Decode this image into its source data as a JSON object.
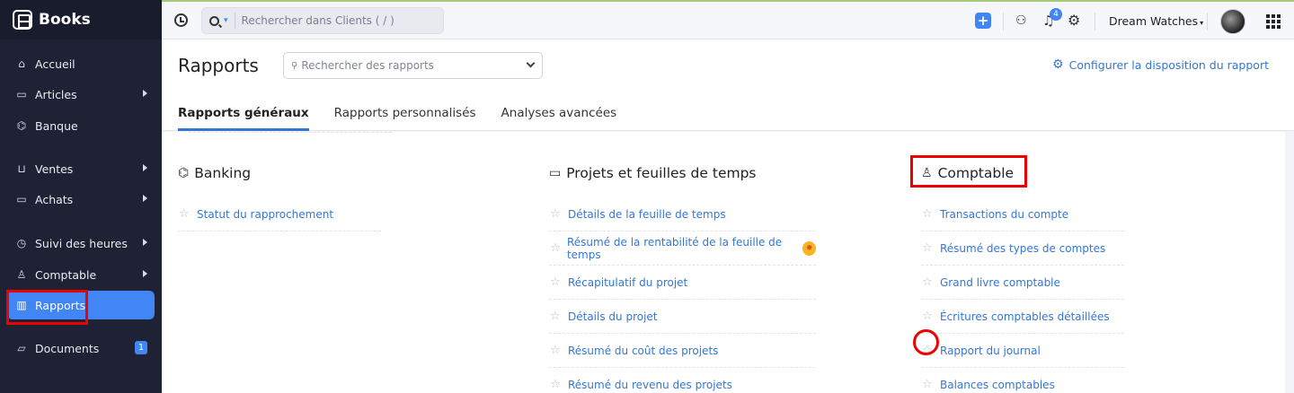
{
  "app": {
    "name": "Books"
  },
  "sidebar": {
    "items": [
      {
        "label": "Accueil",
        "icon": "home-icon"
      },
      {
        "label": "Articles",
        "icon": "bag-icon"
      },
      {
        "label": "Banque",
        "icon": "bank-icon"
      },
      {
        "label": "Ventes",
        "icon": "cart-icon"
      },
      {
        "label": "Achats",
        "icon": "bag-icon"
      },
      {
        "label": "Suivi des heures",
        "icon": "timer-icon"
      },
      {
        "label": "Comptable",
        "icon": "accountant-icon"
      },
      {
        "label": "Rapports",
        "icon": "chart-icon"
      },
      {
        "label": "Documents",
        "icon": "folder-icon",
        "badge": "1"
      }
    ],
    "active": "Rapports"
  },
  "topbar": {
    "search_placeholder": "Rechercher dans Clients ( / )",
    "notifications_count": "4",
    "org_name": "Dream Watches"
  },
  "page": {
    "title": "Rapports",
    "search_placeholder": "Rechercher des rapports",
    "config_link": "Configurer la disposition du rapport",
    "tabs": [
      "Rapports généraux",
      "Rapports personnalisés",
      "Analyses avancées"
    ]
  },
  "sections": {
    "banking": {
      "title": "Banking",
      "items": [
        "Statut du rapprochement"
      ]
    },
    "projects": {
      "title": "Projets et feuilles de temps",
      "items": [
        "Détails de la feuille de temps",
        "Résumé de la rentabilité de la feuille de temps",
        "Récapitulatif du projet",
        "Détails du projet",
        "Résumé du coût des projets",
        "Résumé du revenu des projets"
      ]
    },
    "accounting": {
      "title": "Comptable",
      "items": [
        "Transactions du compte",
        "Résumé des types de comptes",
        "Grand livre comptable",
        "Écritures comptables détaillées",
        "Rapport du journal",
        "Balances comptables"
      ]
    }
  },
  "colors": {
    "accent": "#4285f4",
    "link": "#3477d3",
    "sidebar": "#1f2235",
    "highlight": "#e00000"
  }
}
